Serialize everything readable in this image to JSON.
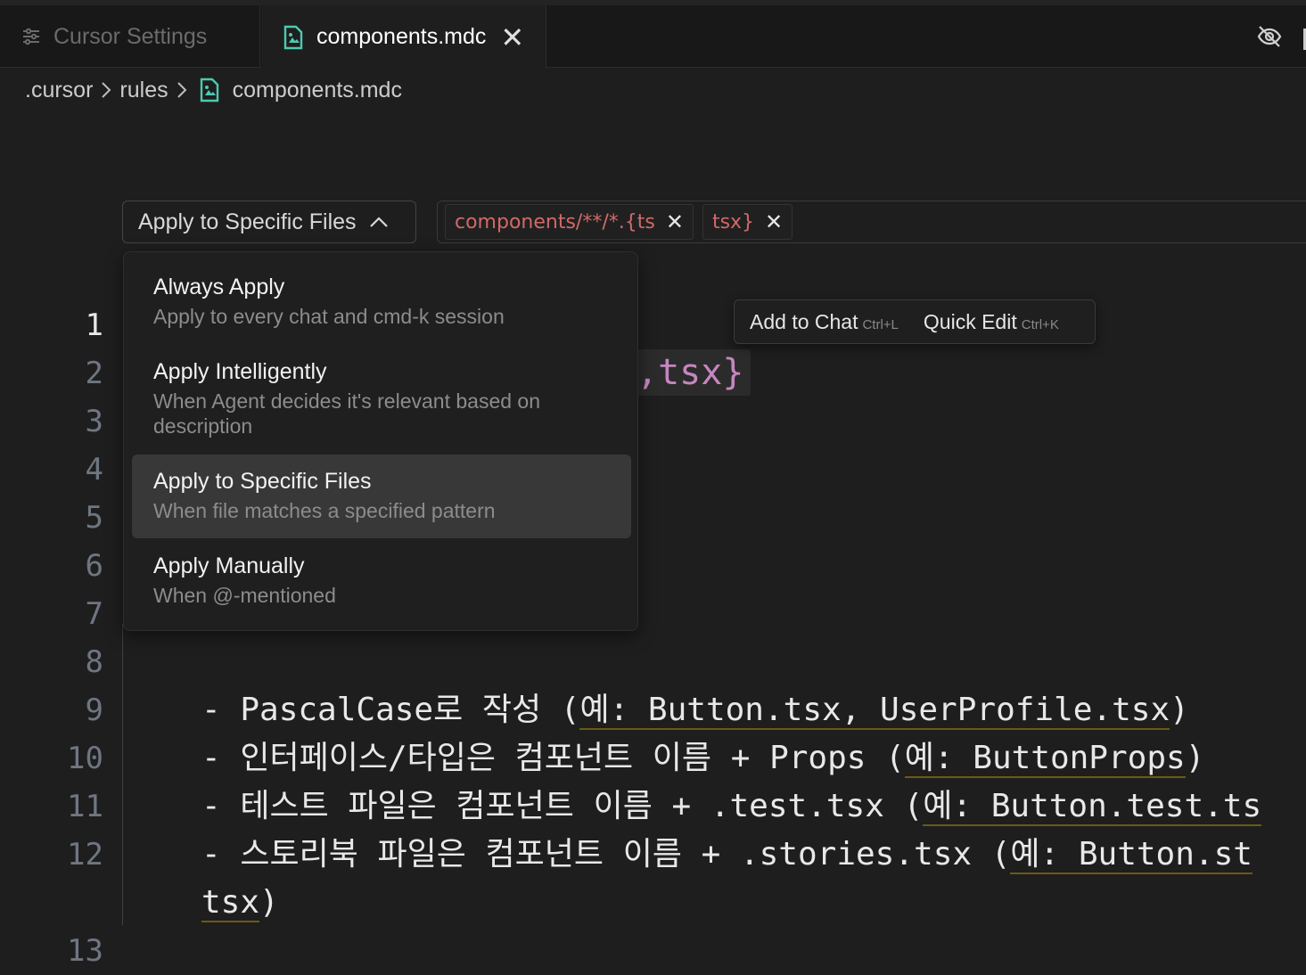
{
  "tabs": [
    {
      "label": "Cursor Settings",
      "icon": "sliders-icon",
      "active": false
    },
    {
      "label": "components.mdc",
      "icon": "mdc-file-icon",
      "active": true,
      "close": "✕"
    }
  ],
  "breadcrumb": {
    "parts": [
      ".cursor",
      "rules",
      "components.mdc"
    ]
  },
  "rule_type": {
    "selected_label": "Apply to Specific Files",
    "options": [
      {
        "title": "Always Apply",
        "description": "Apply to every chat and cmd-k session"
      },
      {
        "title": "Apply Intelligently",
        "description": "When Agent decides it's relevant based on description"
      },
      {
        "title": "Apply to Specific Files",
        "description": "When file matches a specified pattern",
        "selected": true
      },
      {
        "title": "Apply Manually",
        "description": "When @-mentioned"
      }
    ]
  },
  "globs": {
    "chips": [
      "components/**/*.{ts",
      "tsx}"
    ],
    "remove_glyph": "✕"
  },
  "floating_toolbar": {
    "add_to_chat": "Add to Chat",
    "add_to_chat_key": "Ctrl+L",
    "quick_edit": "Quick Edit",
    "quick_edit_key": "Ctrl+K"
  },
  "editor": {
    "line_numbers": [
      "1",
      "2",
      "3",
      "4",
      "5",
      "6",
      "7",
      "8",
      "9",
      "10",
      "11",
      "12",
      "13"
    ],
    "active_line": "1",
    "glob_fragment": ",tsx}",
    "lines": [
      {
        "num": "9",
        "prefix": "- PascalCase로 작성 (",
        "link": "예: Button.tsx, UserProfile.tsx",
        "suffix": ")"
      },
      {
        "num": "10",
        "prefix": "- 인터페이스/타입은 컴포넌트 이름 + Props (",
        "link": "예: ButtonProps",
        "suffix": ")"
      },
      {
        "num": "11",
        "prefix": "- 테스트 파일은 컴포넌트 이름 + .test.tsx (",
        "link": "예: Button.test.ts",
        "suffix": ""
      },
      {
        "num": "12",
        "prefix": "- 스토리북 파일은 컴포넌트 이름 + .stories.tsx (",
        "link": "예: Button.st",
        "suffix": ""
      },
      {
        "num": "",
        "prefix": "",
        "link": "tsx",
        "suffix": ")"
      }
    ]
  }
}
